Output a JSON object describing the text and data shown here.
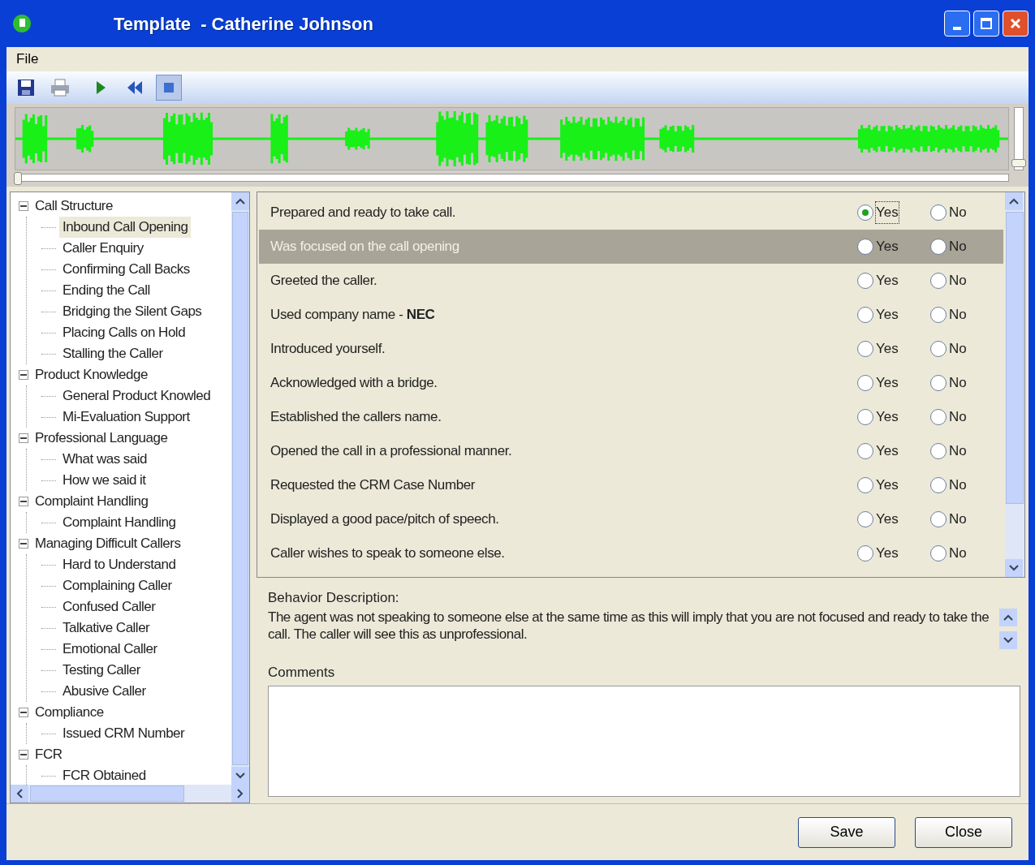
{
  "window": {
    "title": "Template  - Catherine Johnson"
  },
  "menu": [
    "File"
  ],
  "player": {
    "position": {
      "level": 0.0
    },
    "volume": {
      "level": 0.1
    }
  },
  "tree": [
    {
      "label": "Call Structure",
      "expanded": true,
      "selected": false,
      "children": [
        {
          "label": "Inbound Call Opening",
          "selected": true
        },
        {
          "label": "Caller Enquiry",
          "selected": false
        },
        {
          "label": "Confirming Call Backs",
          "selected": false
        },
        {
          "label": "Ending the Call",
          "selected": false
        },
        {
          "label": "Bridging the Silent Gaps",
          "selected": false
        },
        {
          "label": "Placing Calls on Hold",
          "selected": false
        },
        {
          "label": "Stalling the Caller",
          "selected": false
        }
      ]
    },
    {
      "label": "Product Knowledge",
      "expanded": true,
      "selected": false,
      "children": [
        {
          "label": "General Product Knowled",
          "selected": false
        },
        {
          "label": "Mi-Evaluation Support",
          "selected": false
        }
      ]
    },
    {
      "label": "Professional Language",
      "expanded": true,
      "selected": false,
      "children": [
        {
          "label": "What was said",
          "selected": false
        },
        {
          "label": "How we said it",
          "selected": false
        }
      ]
    },
    {
      "label": "Complaint Handling",
      "expanded": true,
      "selected": false,
      "children": [
        {
          "label": "Complaint Handling",
          "selected": false
        }
      ]
    },
    {
      "label": "Managing Difficult Callers",
      "expanded": true,
      "selected": false,
      "children": [
        {
          "label": "Hard to Understand",
          "selected": false
        },
        {
          "label": "Complaining Caller",
          "selected": false
        },
        {
          "label": "Confused Caller",
          "selected": false
        },
        {
          "label": "Talkative Caller",
          "selected": false
        },
        {
          "label": "Emotional Caller",
          "selected": false
        },
        {
          "label": "Testing Caller",
          "selected": false
        },
        {
          "label": "Abusive Caller",
          "selected": false
        }
      ]
    },
    {
      "label": "Compliance",
      "expanded": true,
      "selected": false,
      "children": [
        {
          "label": "Issued CRM Number",
          "selected": false
        }
      ]
    },
    {
      "label": "FCR",
      "expanded": true,
      "selected": false,
      "children": [
        {
          "label": "FCR Obtained",
          "selected": false
        }
      ]
    }
  ],
  "questions": [
    {
      "text": "Prepared and ready to take call.",
      "selected": false,
      "options": [
        {
          "label": "Yes",
          "selected": true
        },
        {
          "label": "No",
          "selected": false
        }
      ]
    },
    {
      "text": "Was focused on the call opening",
      "selected": true,
      "options": [
        {
          "label": "Yes",
          "selected": false
        },
        {
          "label": "No",
          "selected": false
        }
      ]
    },
    {
      "text": "Greeted the caller.",
      "selected": false,
      "options": [
        {
          "label": "Yes",
          "selected": false
        },
        {
          "label": "No",
          "selected": false
        }
      ]
    },
    {
      "text": "Used company name - **NEC**",
      "selected": false,
      "options": [
        {
          "label": "Yes",
          "selected": false
        },
        {
          "label": "No",
          "selected": false
        }
      ]
    },
    {
      "text": "Introduced yourself.",
      "selected": false,
      "options": [
        {
          "label": "Yes",
          "selected": false
        },
        {
          "label": "No",
          "selected": false
        }
      ]
    },
    {
      "text": "Acknowledged with a bridge.",
      "selected": false,
      "options": [
        {
          "label": "Yes",
          "selected": false
        },
        {
          "label": "No",
          "selected": false
        }
      ]
    },
    {
      "text": "Established the callers name.",
      "selected": false,
      "options": [
        {
          "label": "Yes",
          "selected": false
        },
        {
          "label": "No",
          "selected": false
        }
      ]
    },
    {
      "text": "Opened the call in a professional manner.",
      "selected": false,
      "options": [
        {
          "label": "Yes",
          "selected": false
        },
        {
          "label": "No",
          "selected": false
        }
      ]
    },
    {
      "text": "Requested the CRM  Case Number",
      "selected": false,
      "options": [
        {
          "label": "Yes",
          "selected": false
        },
        {
          "label": "No",
          "selected": false
        }
      ]
    },
    {
      "text": "Displayed a good pace/pitch of speech.",
      "selected": false,
      "options": [
        {
          "label": "Yes",
          "selected": false
        },
        {
          "label": "No",
          "selected": false
        }
      ]
    },
    {
      "text": "Caller wishes to speak to someone else.",
      "selected": false,
      "options": [
        {
          "label": "Yes",
          "selected": false
        },
        {
          "label": "No",
          "selected": false
        }
      ]
    }
  ],
  "behavior": {
    "label": "Behavior Description:",
    "text": "The agent was not speaking to someone else at the same time as this will imply that you are not focused and ready to take the call. The caller will see this as unprofessional."
  },
  "comments": {
    "label": "Comments"
  },
  "buttons": [
    "Save",
    "Close"
  ]
}
